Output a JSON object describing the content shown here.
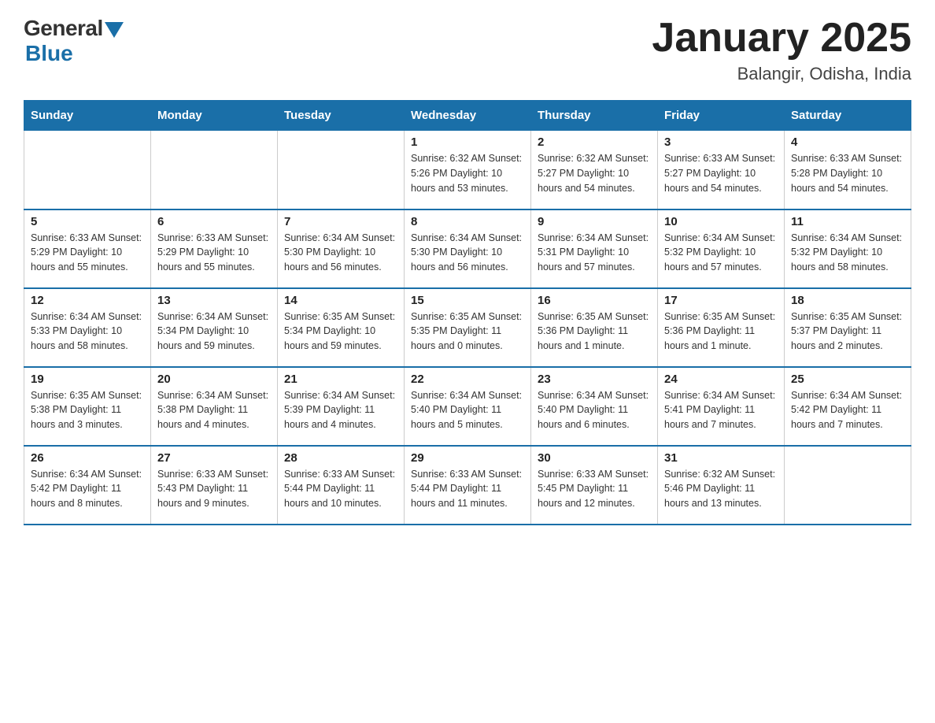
{
  "logo": {
    "general": "General",
    "blue": "Blue",
    "underline": "Blue"
  },
  "header": {
    "title": "January 2025",
    "subtitle": "Balangir, Odisha, India"
  },
  "days_of_week": [
    "Sunday",
    "Monday",
    "Tuesday",
    "Wednesday",
    "Thursday",
    "Friday",
    "Saturday"
  ],
  "weeks": [
    [
      {
        "day": "",
        "info": ""
      },
      {
        "day": "",
        "info": ""
      },
      {
        "day": "",
        "info": ""
      },
      {
        "day": "1",
        "info": "Sunrise: 6:32 AM\nSunset: 5:26 PM\nDaylight: 10 hours and 53 minutes."
      },
      {
        "day": "2",
        "info": "Sunrise: 6:32 AM\nSunset: 5:27 PM\nDaylight: 10 hours and 54 minutes."
      },
      {
        "day": "3",
        "info": "Sunrise: 6:33 AM\nSunset: 5:27 PM\nDaylight: 10 hours and 54 minutes."
      },
      {
        "day": "4",
        "info": "Sunrise: 6:33 AM\nSunset: 5:28 PM\nDaylight: 10 hours and 54 minutes."
      }
    ],
    [
      {
        "day": "5",
        "info": "Sunrise: 6:33 AM\nSunset: 5:29 PM\nDaylight: 10 hours and 55 minutes."
      },
      {
        "day": "6",
        "info": "Sunrise: 6:33 AM\nSunset: 5:29 PM\nDaylight: 10 hours and 55 minutes."
      },
      {
        "day": "7",
        "info": "Sunrise: 6:34 AM\nSunset: 5:30 PM\nDaylight: 10 hours and 56 minutes."
      },
      {
        "day": "8",
        "info": "Sunrise: 6:34 AM\nSunset: 5:30 PM\nDaylight: 10 hours and 56 minutes."
      },
      {
        "day": "9",
        "info": "Sunrise: 6:34 AM\nSunset: 5:31 PM\nDaylight: 10 hours and 57 minutes."
      },
      {
        "day": "10",
        "info": "Sunrise: 6:34 AM\nSunset: 5:32 PM\nDaylight: 10 hours and 57 minutes."
      },
      {
        "day": "11",
        "info": "Sunrise: 6:34 AM\nSunset: 5:32 PM\nDaylight: 10 hours and 58 minutes."
      }
    ],
    [
      {
        "day": "12",
        "info": "Sunrise: 6:34 AM\nSunset: 5:33 PM\nDaylight: 10 hours and 58 minutes."
      },
      {
        "day": "13",
        "info": "Sunrise: 6:34 AM\nSunset: 5:34 PM\nDaylight: 10 hours and 59 minutes."
      },
      {
        "day": "14",
        "info": "Sunrise: 6:35 AM\nSunset: 5:34 PM\nDaylight: 10 hours and 59 minutes."
      },
      {
        "day": "15",
        "info": "Sunrise: 6:35 AM\nSunset: 5:35 PM\nDaylight: 11 hours and 0 minutes."
      },
      {
        "day": "16",
        "info": "Sunrise: 6:35 AM\nSunset: 5:36 PM\nDaylight: 11 hours and 1 minute."
      },
      {
        "day": "17",
        "info": "Sunrise: 6:35 AM\nSunset: 5:36 PM\nDaylight: 11 hours and 1 minute."
      },
      {
        "day": "18",
        "info": "Sunrise: 6:35 AM\nSunset: 5:37 PM\nDaylight: 11 hours and 2 minutes."
      }
    ],
    [
      {
        "day": "19",
        "info": "Sunrise: 6:35 AM\nSunset: 5:38 PM\nDaylight: 11 hours and 3 minutes."
      },
      {
        "day": "20",
        "info": "Sunrise: 6:34 AM\nSunset: 5:38 PM\nDaylight: 11 hours and 4 minutes."
      },
      {
        "day": "21",
        "info": "Sunrise: 6:34 AM\nSunset: 5:39 PM\nDaylight: 11 hours and 4 minutes."
      },
      {
        "day": "22",
        "info": "Sunrise: 6:34 AM\nSunset: 5:40 PM\nDaylight: 11 hours and 5 minutes."
      },
      {
        "day": "23",
        "info": "Sunrise: 6:34 AM\nSunset: 5:40 PM\nDaylight: 11 hours and 6 minutes."
      },
      {
        "day": "24",
        "info": "Sunrise: 6:34 AM\nSunset: 5:41 PM\nDaylight: 11 hours and 7 minutes."
      },
      {
        "day": "25",
        "info": "Sunrise: 6:34 AM\nSunset: 5:42 PM\nDaylight: 11 hours and 7 minutes."
      }
    ],
    [
      {
        "day": "26",
        "info": "Sunrise: 6:34 AM\nSunset: 5:42 PM\nDaylight: 11 hours and 8 minutes."
      },
      {
        "day": "27",
        "info": "Sunrise: 6:33 AM\nSunset: 5:43 PM\nDaylight: 11 hours and 9 minutes."
      },
      {
        "day": "28",
        "info": "Sunrise: 6:33 AM\nSunset: 5:44 PM\nDaylight: 11 hours and 10 minutes."
      },
      {
        "day": "29",
        "info": "Sunrise: 6:33 AM\nSunset: 5:44 PM\nDaylight: 11 hours and 11 minutes."
      },
      {
        "day": "30",
        "info": "Sunrise: 6:33 AM\nSunset: 5:45 PM\nDaylight: 11 hours and 12 minutes."
      },
      {
        "day": "31",
        "info": "Sunrise: 6:32 AM\nSunset: 5:46 PM\nDaylight: 11 hours and 13 minutes."
      },
      {
        "day": "",
        "info": ""
      }
    ]
  ]
}
